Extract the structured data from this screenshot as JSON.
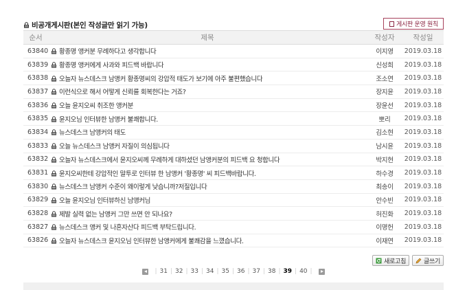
{
  "board": {
    "title": "비공개게시판(본인 작성글만 읽기 가능)",
    "policy_link": "게시판 운영 원칙"
  },
  "columns": {
    "num": "순서",
    "title": "제목",
    "author": "작성자",
    "date": "작성일"
  },
  "posts": [
    {
      "num": "63840",
      "title": "황종명 앵커분 무례하다고 생각합니다",
      "author": "이지영",
      "date": "2019.03.18"
    },
    {
      "num": "63839",
      "title": "황종명 앵커에게 사과와 피드백 바랍니다",
      "author": "신성희",
      "date": "2019.03.18"
    },
    {
      "num": "63838",
      "title": "오늘자 뉴스데스크 남앵커 황종명씨의 강압적 태도가 보기에 아주 불편했습니다",
      "author": "조소연",
      "date": "2019.03.18"
    },
    {
      "num": "63837",
      "title": "이런식으로 해서 어떻게 신뢰를 회복한다는 거죠?",
      "author": "장지윤",
      "date": "2019.03.18"
    },
    {
      "num": "63836",
      "title": "오늘 윤지오씨 취조한 앵커분",
      "author": "장윤선",
      "date": "2019.03.18"
    },
    {
      "num": "63835",
      "title": "윤지오님 인터뷰한 남앵커 불쾌합니다.",
      "author": "뽀리",
      "date": "2019.03.18"
    },
    {
      "num": "63834",
      "title": "뉴스데스크 남앵커의 태도",
      "author": "김소현",
      "date": "2019.03.18"
    },
    {
      "num": "63833",
      "title": "오늘 뉴스데스크 남앵커 자질이 의심됩니다",
      "author": "남시윤",
      "date": "2019.03.18"
    },
    {
      "num": "63832",
      "title": "오늘자 뉴스데스크에서 윤지오씨께 무례하게 대하셨던 남앵커분의 피드백 요 청합니다",
      "author": "박지현",
      "date": "2019.03.18"
    },
    {
      "num": "63831",
      "title": "윤지오씨한테 강압적인 말투로 인터뷰 한 남앵커 '황종명' 씨 피드백바랍니다.",
      "author": "하수경",
      "date": "2019.03.18"
    },
    {
      "num": "63830",
      "title": "뉴스데스크 남앵커 수준이 왜이렇게 낮습니까?저질입니다",
      "author": "최송이",
      "date": "2019.03.18"
    },
    {
      "num": "63829",
      "title": "오늘 윤지오님 인터뷰하신 남앵커님",
      "author": "안수빈",
      "date": "2019.03.18"
    },
    {
      "num": "63828",
      "title": "제발 실력 없는 남앵커 그만 쓰면 안 되나요?",
      "author": "허진화",
      "date": "2019.03.18"
    },
    {
      "num": "63827",
      "title": "뉴스데스크 앵커 및 나혼자산다 피드백 부탁드립니다.",
      "author": "이명헌",
      "date": "2019.03.18"
    },
    {
      "num": "63826",
      "title": "오늘자 뉴스데스크 윤지오님 인터뷰한 남앵커에게 불쾌감을 느꼈습니다.",
      "author": "이재연",
      "date": "2019.03.18"
    }
  ],
  "actions": {
    "refresh": "새로고침",
    "write": "글쓰기"
  },
  "pagination": {
    "pages": [
      "31",
      "32",
      "33",
      "34",
      "35",
      "36",
      "37",
      "38",
      "39",
      "40"
    ],
    "current": "39"
  },
  "colors": {
    "policy_accent": "#8a2340",
    "header_bg": "#f2f2f2"
  }
}
